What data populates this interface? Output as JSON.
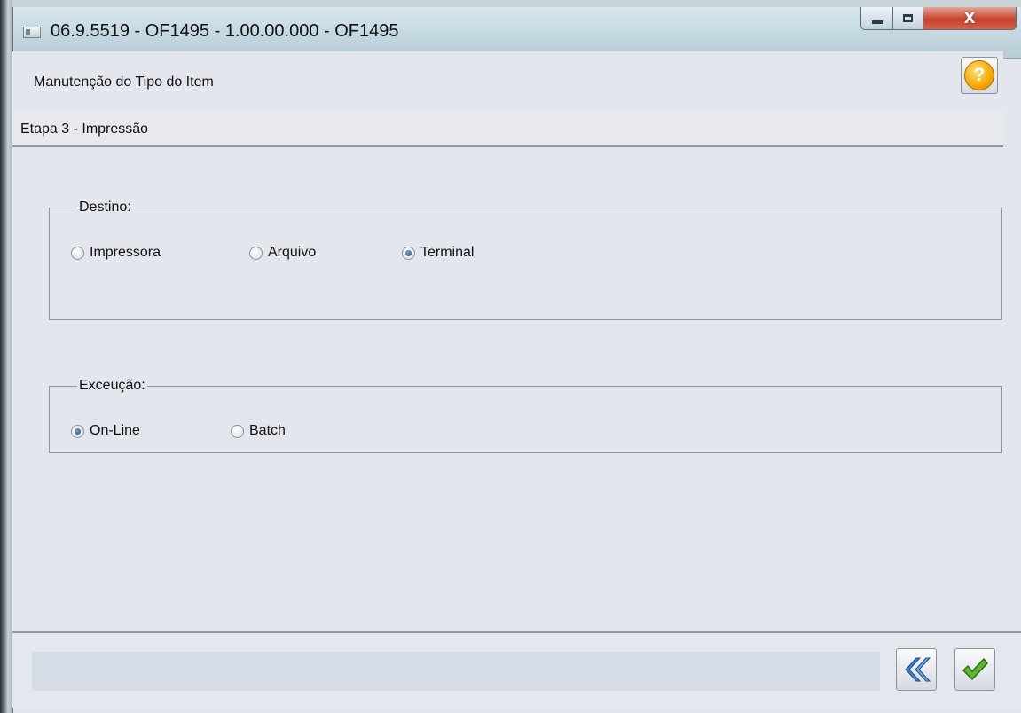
{
  "window": {
    "title": "06.9.5519 - OF1495 - 1.00.00.000 - OF1495",
    "close_label": "X"
  },
  "header": {
    "page_title": "Manutenção do Tipo do Item",
    "help_label": "?"
  },
  "step": {
    "label": "Etapa 3 - Impressão"
  },
  "destino": {
    "legend": "Destino:",
    "options": [
      {
        "label": "Impressora",
        "selected": false
      },
      {
        "label": "Arquivo",
        "selected": false
      },
      {
        "label": "Terminal",
        "selected": true
      }
    ]
  },
  "execucao": {
    "legend": "Exceução:",
    "options": [
      {
        "label": "On-Line",
        "selected": true
      },
      {
        "label": "Batch",
        "selected": false
      }
    ]
  },
  "footer": {
    "status_text": ""
  },
  "colors": {
    "background": "#e3e6ed",
    "accent_blue": "#3f7fd0",
    "ok_green": "#5cb82e",
    "help_orange": "#f6a800",
    "close_red": "#c6422c"
  },
  "icons": {
    "back": "double-chevron-left-icon",
    "ok": "checkmark-icon",
    "help": "question-mark-icon"
  }
}
